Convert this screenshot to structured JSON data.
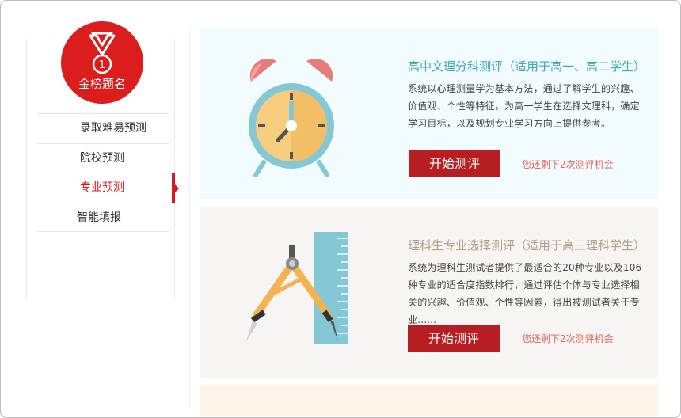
{
  "sidebar": {
    "badge_label": "金榜题名",
    "medal_number": "1",
    "items": [
      {
        "label": "录取难易预测",
        "active": false
      },
      {
        "label": "院校预测",
        "active": false
      },
      {
        "label": "专业预测",
        "active": true
      },
      {
        "label": "智能填报",
        "active": false
      }
    ]
  },
  "cards": [
    {
      "title": "高中文理分科测评（适用于高一、高二学生）",
      "description": "系统以心理测量学为基本方法，通过了解学生的兴趣、价值观、个性等特征，为高一学生在选择文理科，确定学习目标，以及规划专业学习方向上提供参考。",
      "button": "开始测评",
      "remaining": "您还剩下2次测评机会",
      "illustration": "alarm-clock-icon"
    },
    {
      "title": "理科生专业选择测评（适用于高三理科学生）",
      "description": "系统为理科生测试者提供了最适合的20种专业以及106种专业的适合度指数排行，通过评估个体与专业选择相关的兴趣、价值观、个性等因素，得出被测试者关于专业......",
      "button": "开始测评",
      "remaining": "您还剩下2次测评机会",
      "illustration": "compass-ruler-icon"
    }
  ],
  "colors": {
    "brand_red": "#dc1d1d",
    "button_red": "#b61e21",
    "card1_bg": "#f2fbfd",
    "card2_bg": "#f6f5f3",
    "card3_bg": "#fdf3e9",
    "title1": "#3fa7b8",
    "title2": "#b49d88"
  }
}
